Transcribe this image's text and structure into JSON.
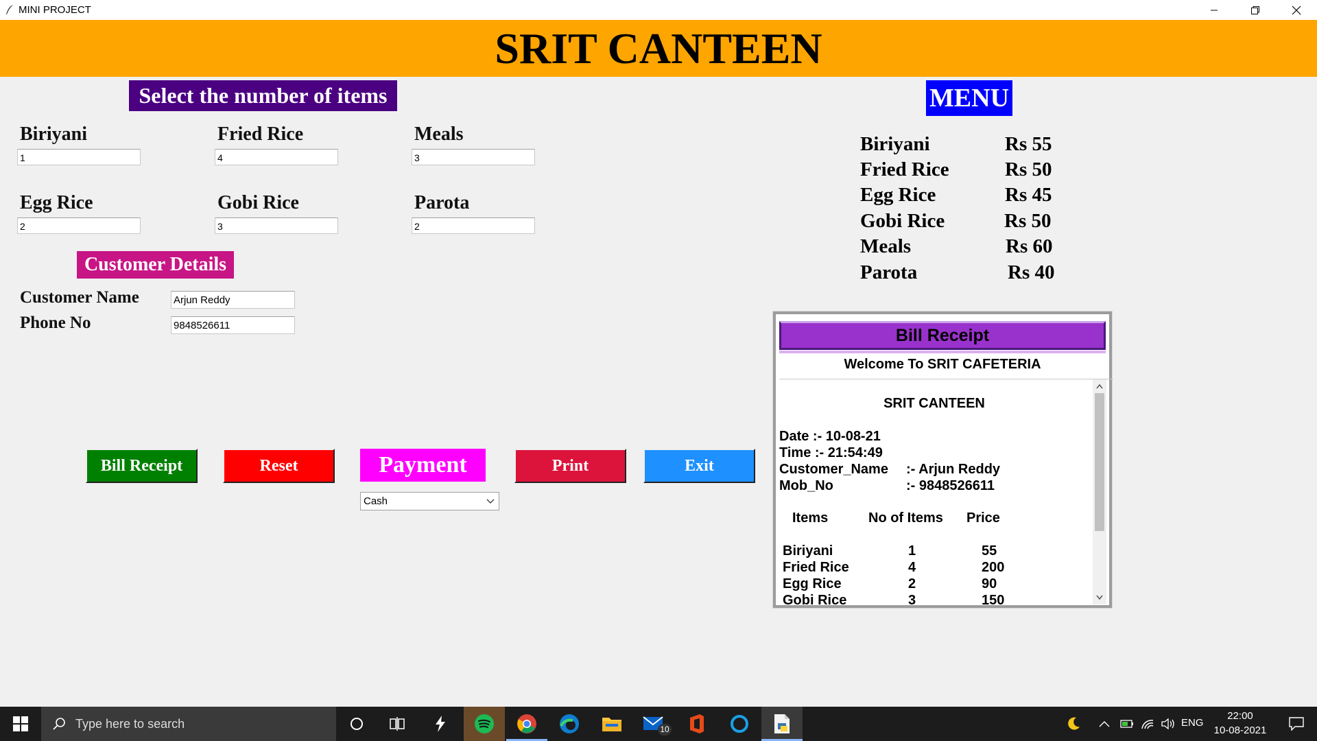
{
  "window": {
    "title": "MINI PROJECT"
  },
  "header": {
    "title": "SRIT CANTEEN"
  },
  "items_section": {
    "heading": "Select the number of items",
    "items": [
      {
        "label": "Biriyani",
        "value": "1"
      },
      {
        "label": "Fried Rice",
        "value": "4"
      },
      {
        "label": "Meals",
        "value": "3"
      },
      {
        "label": "Egg Rice",
        "value": "2"
      },
      {
        "label": "Gobi Rice",
        "value": "3"
      },
      {
        "label": "Parota",
        "value": "2"
      }
    ]
  },
  "customer": {
    "heading": "Customer Details",
    "name_label": "Customer Name",
    "name_value": "Arjun Reddy",
    "phone_label": "Phone No",
    "phone_value": "9848526611"
  },
  "buttons": {
    "bill": "Bill Receipt",
    "reset": "Reset",
    "payment": "Payment",
    "print": "Print",
    "exit": "Exit"
  },
  "payment_select": {
    "selected": "Cash"
  },
  "menu": {
    "heading": "MENU",
    "entries": [
      {
        "name": "Biriyani",
        "price": "Rs 55"
      },
      {
        "name": "Fried Rice",
        "price": "Rs 50"
      },
      {
        "name": "Egg Rice",
        "price": "Rs 45"
      },
      {
        "name": "Gobi Rice",
        "price": "Rs 50"
      },
      {
        "name": "Meals",
        "price": "Rs 60"
      },
      {
        "name": "Parota",
        "price": "Rs 40"
      }
    ]
  },
  "receipt": {
    "title": "Bill Receipt",
    "welcome": "Welcome To SRIT CAFETERIA",
    "canteen": "SRIT CANTEEN",
    "date": "Date :-  10-08-21",
    "time": "Time :-  21:54:49",
    "customer_label": "Customer_Name",
    "customer_value": ":-  Arjun Reddy",
    "mob_label": "Mob_No",
    "mob_value": ":-  9848526611",
    "col_items": "Items",
    "col_count": "No of Items",
    "col_price": "Price",
    "rows": [
      {
        "item": "Biriyani",
        "count": "1",
        "price": "55"
      },
      {
        "item": "Fried Rice",
        "count": "4",
        "price": "200"
      },
      {
        "item": "Egg Rice",
        "count": "2",
        "price": "90"
      },
      {
        "item": "Gobi Rice",
        "count": "3",
        "price": "150"
      }
    ]
  },
  "taskbar": {
    "search_placeholder": "Type here to search",
    "mail_badge": "10",
    "lang": "ENG",
    "time": "22:00",
    "date": "10-08-2021"
  },
  "colors": {
    "header": "#ffa500",
    "items_heading": "#4b0082",
    "customer_heading": "#c71585",
    "menu_heading": "#0000ff",
    "bill_button": "#008000",
    "reset_button": "#ff0000",
    "payment_button": "#ff00ff",
    "print_button": "#dc143c",
    "exit_button": "#1e90ff",
    "receipt_title": "#9932cc"
  }
}
